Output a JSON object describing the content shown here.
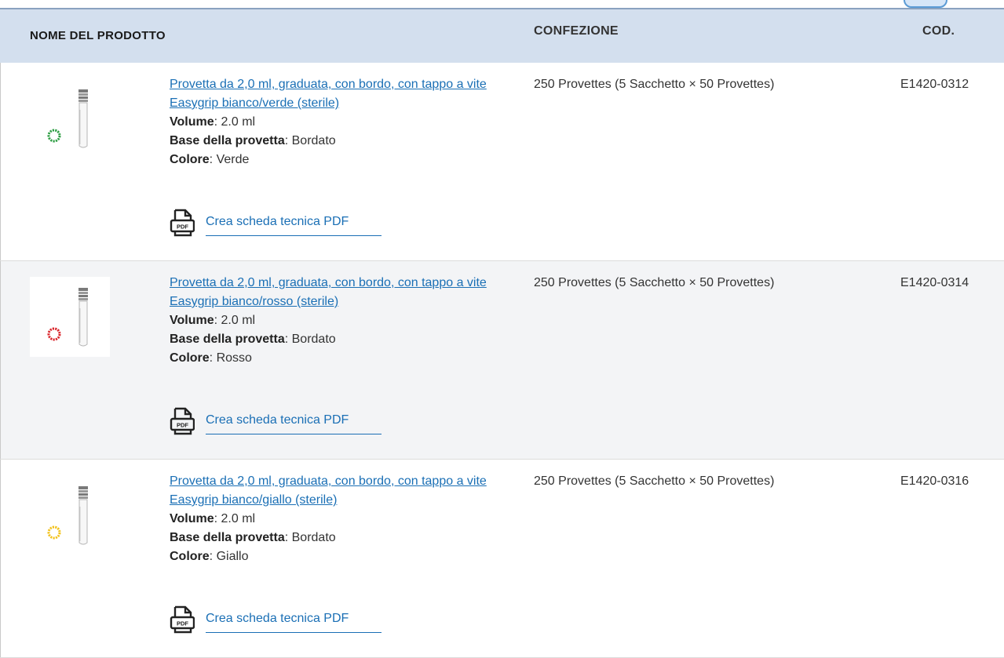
{
  "header": {
    "col_name": "NOME DEL PRODOTTO",
    "col_pack": "CONFEZIONE",
    "col_code": "COD."
  },
  "rows": [
    {
      "title": "Provetta da 2,0 ml, graduata, con bordo, con tappo a vite Easygrip bianco/verde (sterile)",
      "volume_label": "Volume",
      "volume_value": ": 2.0 ml",
      "base_label": "Base della provetta",
      "base_value": ": Bordato",
      "color_label": "Colore",
      "color_value": ": Verde",
      "pdf_label": "Crea scheda tecnica PDF",
      "pack": "250 Provettes (5 Sacchetto × 50 Provettes)",
      "code": "E1420-0312",
      "cap_color": "#2e9e44"
    },
    {
      "title": "Provetta da 2,0 ml, graduata, con bordo, con tappo a vite Easygrip bianco/rosso (sterile)",
      "volume_label": "Volume",
      "volume_value": ": 2.0 ml",
      "base_label": "Base della provetta",
      "base_value": ": Bordato",
      "color_label": "Colore",
      "color_value": ": Rosso",
      "pdf_label": "Crea scheda tecnica PDF",
      "pack": "250 Provettes (5 Sacchetto × 50 Provettes)",
      "code": "E1420-0314",
      "cap_color": "#d9262c"
    },
    {
      "title": "Provetta da 2,0 ml, graduata, con bordo, con tappo a vite Easygrip bianco/giallo (sterile)",
      "volume_label": "Volume",
      "volume_value": ": 2.0 ml",
      "base_label": "Base della provetta",
      "base_value": ": Bordato",
      "color_label": "Colore",
      "color_value": ": Giallo",
      "pdf_label": "Crea scheda tecnica PDF",
      "pack": "250 Provettes (5 Sacchetto × 50 Provettes)",
      "code": "E1420-0316",
      "cap_color": "#f2c21b"
    }
  ],
  "colors": {
    "header_bg": "#d3dfee",
    "link": "#1a6fb5",
    "alt_row": "#f3f4f6"
  },
  "icons": {
    "pdf": "pdf-document-icon"
  }
}
